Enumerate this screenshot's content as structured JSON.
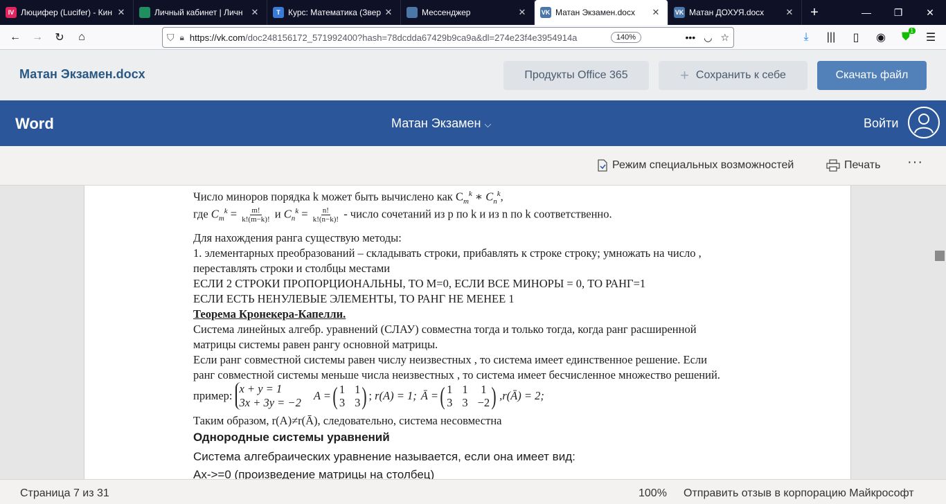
{
  "browser": {
    "tabs": [
      {
        "title": "Люцифер (Lucifer) - Кин",
        "fav_color": "#e0245e",
        "fav_text": "IV",
        "active": false
      },
      {
        "title": "Личный кабинет | Личн",
        "fav_color": "#1f8f5f",
        "fav_text": "",
        "active": false
      },
      {
        "title": "Курс: Математика (Звер",
        "fav_color": "#3a7bd5",
        "fav_text": "T",
        "active": false
      },
      {
        "title": "Мессенджер",
        "fav_color": "#4a76a8",
        "fav_text": "",
        "active": false
      },
      {
        "title": "Матан Экзамен.docx",
        "fav_color": "#4a76a8",
        "fav_text": "VK",
        "active": true
      },
      {
        "title": "Матан ДОХУЯ.docx",
        "fav_color": "#4a76a8",
        "fav_text": "VK",
        "active": false
      }
    ],
    "url_host": "https://vk.com",
    "url_rest": "/doc248156172_571992400?hash=78dcdda67429b9ca9a&dl=274e23f4e3954914a",
    "zoom": "140%",
    "badge_count": "1"
  },
  "header": {
    "doc_title": "Матан Экзамен.docx",
    "office_label": "Продукты Office 365",
    "save_label": "Сохранить к себе",
    "download_label": "Скачать файл"
  },
  "word": {
    "logo": "Word",
    "doc_menu": "Матан Экзамен",
    "signin": "Войти"
  },
  "toolbar": {
    "accessibility": "Режим специальных возможностей",
    "print": "Печать",
    "more": "···"
  },
  "document": {
    "line_minors": "Число миноров порядка k может быть вычислено как C",
    "line_where_pre": "где",
    "line_where_post": "- число сочетаний из p по k и из n по k соответственно.",
    "frac1_num": "m!",
    "frac1_den": "k!(m−k)!",
    "frac2_num": "n!",
    "frac2_den": "k!(n−k)!",
    "lines": [
      "Для нахождения ранга существую методы:",
      "1. элементарных преобразований – складывать строки, прибавлять к строке строку; умножать на число ,",
      "переставлять строки и столбцы местами",
      "ЕСЛИ 2 СТРОКИ ПРОПОРЦИОНАЛЬНЫ,   ТО М=0, ЕСЛИ ВСЕ МИНОРЫ  = 0, ТО  РАНГ=1",
      "ЕСЛИ ЕСТЬ НЕНУЛЕВЫЕ ЭЛЕМЕНТЫ, ТО РАНГ НЕ МЕНЕЕ 1"
    ],
    "theorem_title": "Теорема Кронекера-Капелли.",
    "theorem_lines": [
      "Система линейных  алгебр. уравнений (СЛАУ)  совместна тогда и только тогда, когда ранг расширенной",
      "матрицы системы равен рангу основной матрицы.",
      "Если ранг совместной системы равен числу неизвестных , то система имеет  единственное решение. Если",
      "ранг совместной системы меньше числа неизвестных , то система имеет  бесчисленное множество решений."
    ],
    "example_label": "пример:",
    "eq1": "x + y = 1",
    "eq2": "3x + 3y = −2",
    "rank_a": "r(A) = 1;",
    "rank_abar": "r(Ā) = 2;",
    "conclusion": "Таким образом, r(A)≠r(Ā),  следовательно, система несовместна",
    "homog_title": "Однородные системы уравнений",
    "homog_line1": "Система алгебраических уравнение называется, если она имеет вид:",
    "homog_line2": "Ax->=0 (произведение матрицы на столбец)"
  },
  "status": {
    "pages": "Страница 7 из 31",
    "zoom": "100%",
    "feedback": "Отправить отзыв в корпорацию Майкрософт"
  }
}
